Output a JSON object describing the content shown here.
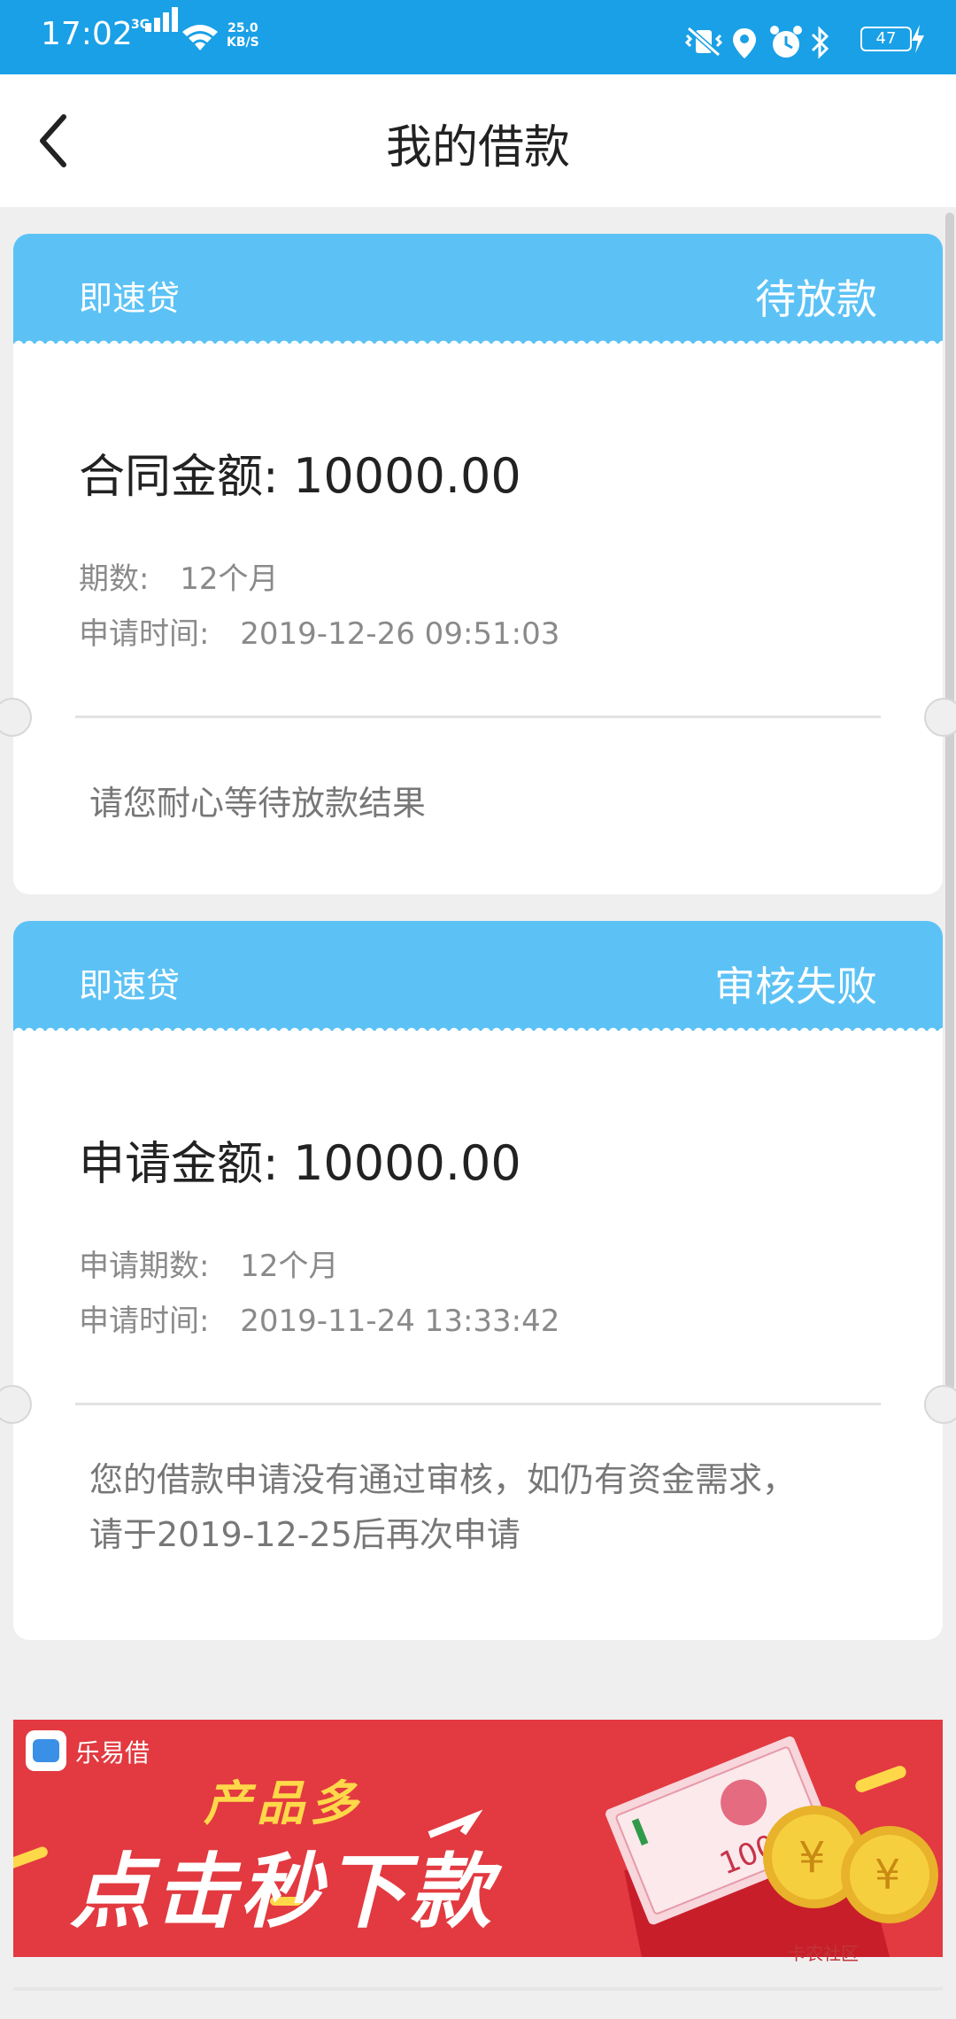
{
  "status_bar": {
    "time": "17:02",
    "network": "3G",
    "speed_value": "25.0",
    "speed_unit": "KB/S",
    "battery": "47"
  },
  "header": {
    "title": "我的借款"
  },
  "loans": [
    {
      "product": "即速贷",
      "status": "待放款",
      "amount_label": "合同金额:",
      "amount": "10000.00",
      "period_label": "期数:",
      "period": "12个月",
      "time_label": "申请时间:",
      "time": "2019-12-26 09:51:03",
      "note_lines": [
        "请您耐心等待放款结果"
      ]
    },
    {
      "product": "即速贷",
      "status": "审核失败",
      "amount_label": "申请金额:",
      "amount": "10000.00",
      "period_label": "申请期数:",
      "period": "12个月",
      "time_label": "申请时间:",
      "time": "2019-11-24 13:33:42",
      "note_lines": [
        "您的借款申请没有通过审核，如仍有资金需求，",
        "请于2019-12-25后再次申请"
      ]
    }
  ],
  "ad": {
    "brand": "乐易借",
    "subtitle": "产品多",
    "headline": "点击秒下款",
    "bill_value": "100",
    "coin_symbol": "¥"
  },
  "watermark": "卡农社区",
  "colors": {
    "status_bar": "#1aa0e6",
    "card_header": "#5cc2f5",
    "ad_background": "#e23a40",
    "ad_subtitle": "#ffd84a"
  }
}
